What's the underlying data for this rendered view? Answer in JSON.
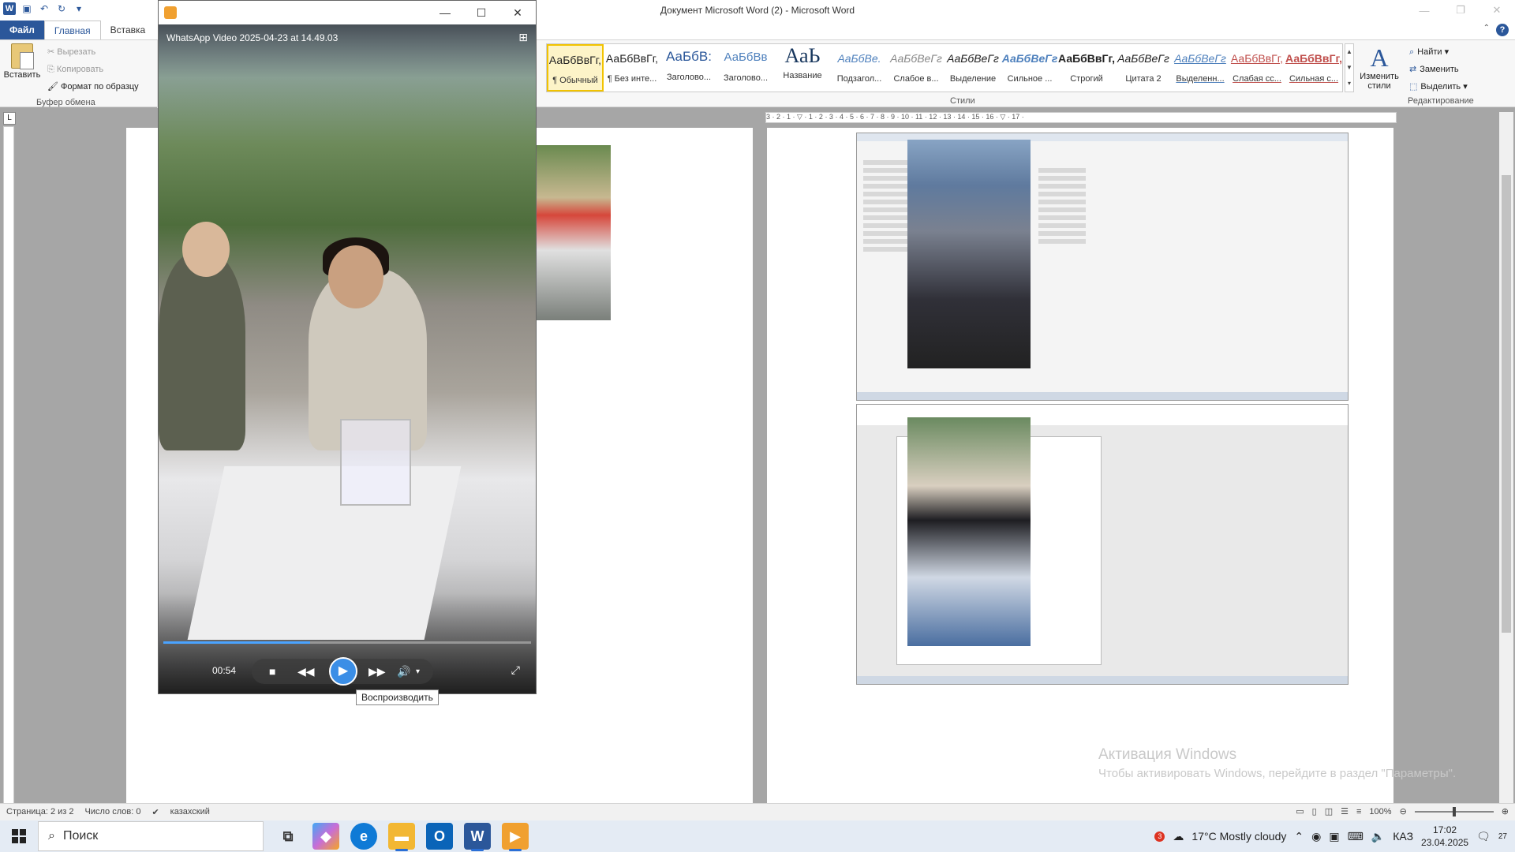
{
  "window": {
    "title": "Документ Microsoft Word (2)  -  Microsoft Word"
  },
  "tabs": [
    {
      "label": "Файл"
    },
    {
      "label": "Главная"
    },
    {
      "label": "Вставка"
    }
  ],
  "clipboard": {
    "paste_label": "Вставить",
    "cut_label": "Вырезать",
    "copy_label": "Копировать",
    "format_label": "Формат по образцу",
    "group_label": "Буфер обмена"
  },
  "styles": {
    "group_label": "Стили",
    "items": [
      {
        "preview": "АаБбВвГг,",
        "name": "¶ Обычный"
      },
      {
        "preview": "АаБбВвГг,",
        "name": "¶ Без инте..."
      },
      {
        "preview": "АаБбВ:",
        "name": "Заголово..."
      },
      {
        "preview": "АаБбВв",
        "name": "Заголово..."
      },
      {
        "preview": "АаЬ",
        "name": "Название"
      },
      {
        "preview": "АаБбВе.",
        "name": "Подзагол..."
      },
      {
        "preview": "АаБбВеГг",
        "name": "Слабое в..."
      },
      {
        "preview": "АаБбВеГг",
        "name": "Выделение"
      },
      {
        "preview": "АаБбВеГг",
        "name": "Сильное ..."
      },
      {
        "preview": "АаБбВвГг,",
        "name": "Строгий"
      },
      {
        "preview": "АаБбВеГг",
        "name": "Цитата 2"
      },
      {
        "preview": "АаБбВеГг",
        "name": "Выделенн..."
      },
      {
        "preview": "АаБбВвГг,",
        "name": "Слабая сс..."
      },
      {
        "preview": "АаБбВвГг,",
        "name": "Сильная с..."
      }
    ],
    "change_label": "Изменить стили"
  },
  "editing": {
    "find_label": "Найти",
    "replace_label": "Заменить",
    "select_label": "Выделить",
    "group_label": "Редактирование"
  },
  "ruler": {
    "text": "3 · 2 · 1 · ▽ · 1 · 2 · 3 · 4 · 5 · 6 · 7 · 8 · 9 · 10 · 11 · 12 · 13 · 14 · 15 · 16 · ▽ · 17 ·"
  },
  "player": {
    "video_title": "WhatsApp Video 2025-04-23 at 14.49.03",
    "time": "00:54",
    "progress": 0.4,
    "tooltip": "Воспроизводить"
  },
  "watermark": {
    "line1": "Активация Windows",
    "line2": "Чтобы активировать Windows, перейдите в раздел \"Параметры\"."
  },
  "statusbar": {
    "page": "Страница: 2 из 2",
    "words": "Число слов: 0",
    "lang": "казахский",
    "zoom": "100%"
  },
  "taskbar": {
    "search_placeholder": "Поиск",
    "weather": "17°C  Mostly cloudy",
    "weather_badge": "3",
    "lang": "КАЗ",
    "time": "17:02",
    "date": "23.04.2025",
    "notif_count": "27"
  }
}
